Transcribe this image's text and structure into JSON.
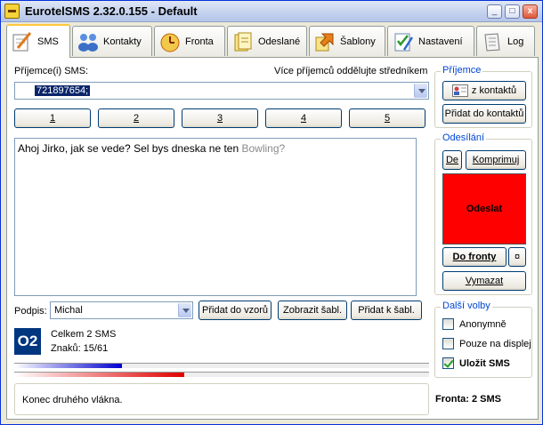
{
  "window": {
    "title": "EurotelSMS 2.32.0.155 - Default"
  },
  "titlebar_buttons": {
    "minimize": "_",
    "maximize": "□",
    "close": "x"
  },
  "tabs": [
    {
      "label": "SMS",
      "icon": "pen-paper-icon"
    },
    {
      "label": "Kontakty",
      "icon": "people-icon"
    },
    {
      "label": "Fronta",
      "icon": "clock-document-icon"
    },
    {
      "label": "Odeslané",
      "icon": "sent-document-icon"
    },
    {
      "label": "Šablony",
      "icon": "template-arrow-icon"
    },
    {
      "label": "Nastavení",
      "icon": "settings-pencil-icon"
    },
    {
      "label": "Log",
      "icon": "log-scroll-icon"
    }
  ],
  "recipient": {
    "label": "Příjemce(i) SMS:",
    "hint": "Více příjemců oddělujte středníkem",
    "value": "721897654;"
  },
  "number_buttons": [
    "1",
    "2",
    "3",
    "4",
    "5"
  ],
  "message": {
    "text_main": "Ahoj Jirko, jak se vede? Sel bys dneska ne ten ",
    "text_faded": "Bowling?"
  },
  "signature": {
    "label": "Podpis:",
    "value": "Michal",
    "add_pattern_button": "Přidat do vzorů",
    "show_template_button": "Zobrazit šabl.",
    "add_to_template_button": "Přidat k šabl."
  },
  "stats": {
    "operator_logo": "O2",
    "total": "Celkem 2 SMS",
    "chars": "Znaků: 15/61",
    "bar1_fill": 0.26,
    "bar2_fill": 0.41
  },
  "status": {
    "message": "Konec druhého vlákna."
  },
  "recipient_group": {
    "title": "Příjemce",
    "from_contacts_button": "z kontaktů",
    "add_contact_button": "Přidat do kontaktů"
  },
  "sending_group": {
    "title": "Odesílání",
    "de_button": "De",
    "compress_button": "Komprimuj",
    "send_button": "Odeslat",
    "to_queue_button": "Do fronty",
    "queue_extra_button": "¤",
    "delete_button": "Vymazat",
    "send_color": "#ff0000"
  },
  "options_group": {
    "title": "Další volby",
    "anonymous": {
      "label": "Anonymně",
      "checked": false
    },
    "display_only": {
      "label": "Pouze na displej",
      "checked": false
    },
    "save_sms": {
      "label": "Uložit SMS",
      "checked": true
    }
  },
  "queue": {
    "text": "Fronta: 2 SMS"
  },
  "colors": {
    "accent_blue": "#0046d5",
    "progress_blue": "#0000d0",
    "progress_red": "#e00000",
    "o2_blue": "#003580"
  }
}
